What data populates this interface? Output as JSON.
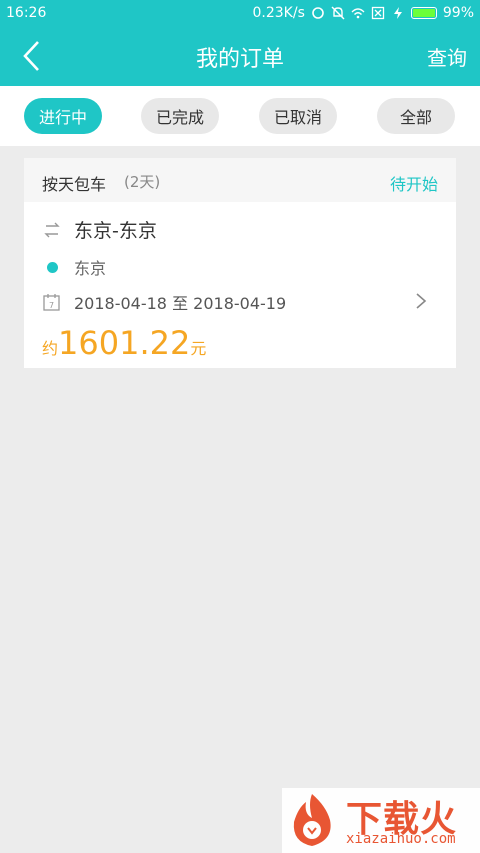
{
  "status_bar": {
    "time": "16:26",
    "net_speed": "0.23K/s",
    "battery": "99%"
  },
  "header": {
    "title": "我的订单",
    "query_label": "查询"
  },
  "tabs": [
    {
      "label": "进行中",
      "active": true
    },
    {
      "label": "已完成",
      "active": false
    },
    {
      "label": "已取消",
      "active": false
    },
    {
      "label": "全部",
      "active": false
    }
  ],
  "order": {
    "service_type": "按天包车",
    "duration": "(2天)",
    "status": "待开始",
    "route": "东京-东京",
    "location": "东京",
    "date_range": "2018-04-18 至 2018-04-19",
    "price_prefix": "约",
    "price": "1601.22",
    "price_unit": "元"
  },
  "watermark": {
    "brand": "下载火",
    "site": "xiazaihuo.com"
  },
  "colors": {
    "accent": "#1fc6c6",
    "price": "#f5a623",
    "watermark": "#e84f2a"
  }
}
